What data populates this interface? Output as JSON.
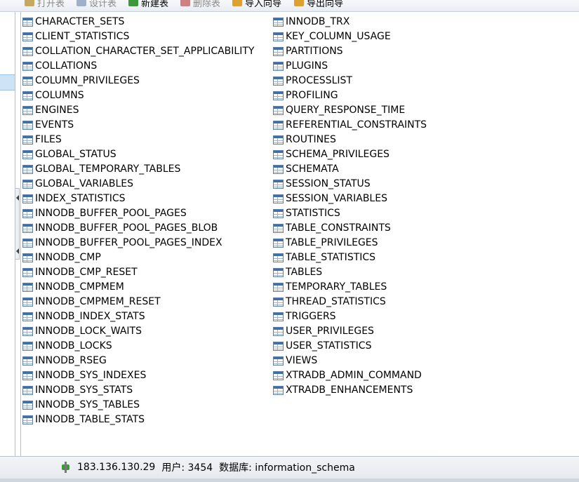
{
  "toolbar": {
    "open_table": "打开表",
    "design_table": "设计表",
    "new_table": "新建表",
    "delete_table": "删除表",
    "import_wizard": "导入向导",
    "export_wizard": "导出向导"
  },
  "tables_left": [
    "CHARACTER_SETS",
    "CLIENT_STATISTICS",
    "COLLATION_CHARACTER_SET_APPLICABILITY",
    "COLLATIONS",
    "COLUMN_PRIVILEGES",
    "COLUMNS",
    "ENGINES",
    "EVENTS",
    "FILES",
    "GLOBAL_STATUS",
    "GLOBAL_TEMPORARY_TABLES",
    "GLOBAL_VARIABLES",
    "INDEX_STATISTICS",
    "INNODB_BUFFER_POOL_PAGES",
    "INNODB_BUFFER_POOL_PAGES_BLOB",
    "INNODB_BUFFER_POOL_PAGES_INDEX",
    "INNODB_CMP",
    "INNODB_CMP_RESET",
    "INNODB_CMPMEM",
    "INNODB_CMPMEM_RESET",
    "INNODB_INDEX_STATS",
    "INNODB_LOCK_WAITS",
    "INNODB_LOCKS",
    "INNODB_RSEG",
    "INNODB_SYS_INDEXES",
    "INNODB_SYS_STATS",
    "INNODB_SYS_TABLES",
    "INNODB_TABLE_STATS"
  ],
  "tables_right": [
    "INNODB_TRX",
    "KEY_COLUMN_USAGE",
    "PARTITIONS",
    "PLUGINS",
    "PROCESSLIST",
    "PROFILING",
    "QUERY_RESPONSE_TIME",
    "REFERENTIAL_CONSTRAINTS",
    "ROUTINES",
    "SCHEMA_PRIVILEGES",
    "SCHEMATA",
    "SESSION_STATUS",
    "SESSION_VARIABLES",
    "STATISTICS",
    "TABLE_CONSTRAINTS",
    "TABLE_PRIVILEGES",
    "TABLE_STATISTICS",
    "TABLES",
    "TEMPORARY_TABLES",
    "THREAD_STATISTICS",
    "TRIGGERS",
    "USER_PRIVILEGES",
    "USER_STATISTICS",
    "VIEWS",
    "XTRADB_ADMIN_COMMAND",
    "XTRADB_ENHANCEMENTS"
  ],
  "icons": {
    "table": "table-icon",
    "connection": "connection-icon"
  },
  "status": {
    "host": "183.136.130.29",
    "user": "用户: 3454",
    "database": "数据库: information_schema"
  }
}
